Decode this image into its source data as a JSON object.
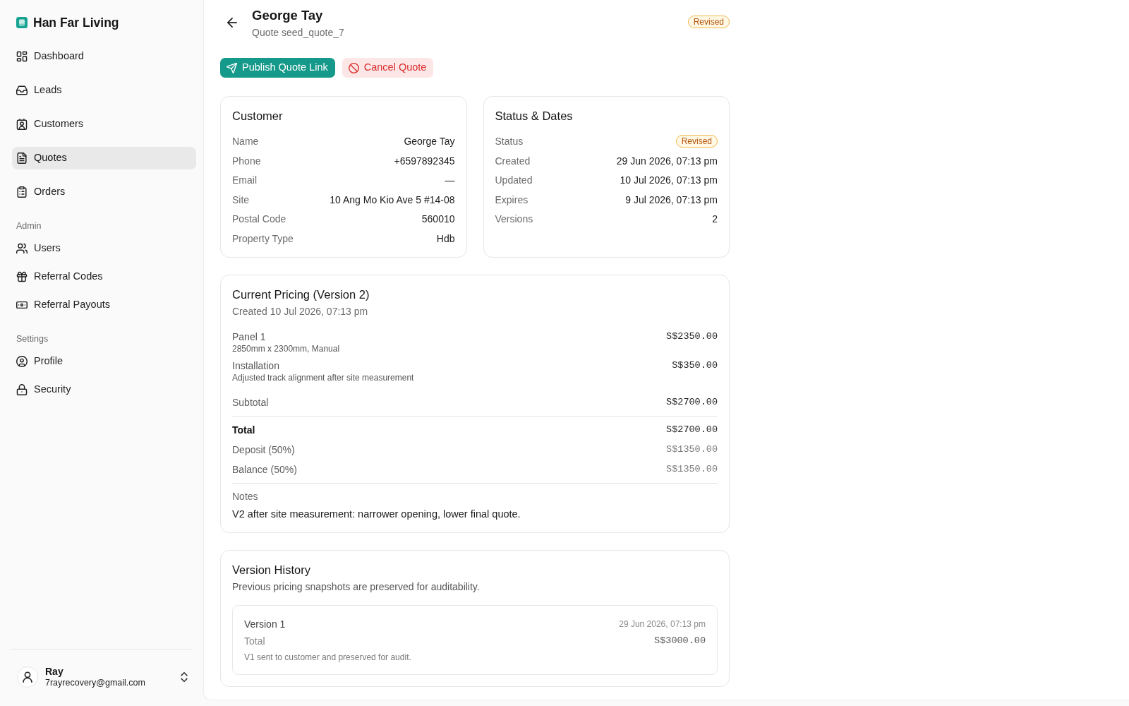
{
  "sidebar": {
    "brand": "Han Far Living",
    "sections": [
      {
        "items": [
          {
            "label": "Dashboard",
            "selected": false
          },
          {
            "label": "Leads",
            "selected": false
          },
          {
            "label": "Customers",
            "selected": false
          },
          {
            "label": "Quotes",
            "selected": true
          },
          {
            "label": "Orders",
            "selected": false
          }
        ]
      },
      {
        "heading": "Admin",
        "items": [
          {
            "label": "Users",
            "selected": false
          },
          {
            "label": "Referral Codes",
            "selected": false
          },
          {
            "label": "Referral Payouts",
            "selected": false
          }
        ]
      },
      {
        "heading": "Settings",
        "items": [
          {
            "label": "Profile",
            "selected": false
          },
          {
            "label": "Security",
            "selected": false
          }
        ]
      }
    ],
    "user": {
      "name": "Ray",
      "email": "7rayrecovery@gmail.com"
    }
  },
  "header": {
    "title": "George Tay",
    "subtitle": "Quote seed_quote_7",
    "status": "Revised"
  },
  "actions": [
    {
      "label": "Publish Quote Link",
      "kind": "primary"
    },
    {
      "label": "Cancel Quote",
      "kind": "danger"
    }
  ],
  "customer": {
    "title": "Customer",
    "fields": [
      {
        "label": "Name",
        "value": "George Tay"
      },
      {
        "label": "Phone",
        "value": "+6597892345"
      },
      {
        "label": "Email",
        "value": "—"
      },
      {
        "label": "Site",
        "value": "10 Ang Mo Kio Ave 5 #14-08"
      },
      {
        "label": "Postal Code",
        "value": "560010"
      },
      {
        "label": "Property Type",
        "value": "Hdb"
      }
    ]
  },
  "status_dates": {
    "title": "Status & Dates",
    "fields": [
      {
        "label": "Status",
        "value": "Revised",
        "kind": "badge"
      },
      {
        "label": "Created",
        "value": "29 Jun 2026, 07:13 pm",
        "kind": "text"
      },
      {
        "label": "Updated",
        "value": "10 Jul 2026, 07:13 pm",
        "kind": "text"
      },
      {
        "label": "Expires",
        "value": "9 Jul 2026, 07:13 pm",
        "kind": "text"
      },
      {
        "label": "Versions",
        "value": "2",
        "kind": "text"
      }
    ]
  },
  "pricing": {
    "title": "Current Pricing (Version 2)",
    "subtitle": "Created 10 Jul 2026, 07:13 pm",
    "line_items": [
      {
        "name": "Panel 1",
        "detail": "2850mm x 2300mm, Manual",
        "amount": "S$2350.00"
      },
      {
        "name": "Installation",
        "detail": "Adjusted track alignment after site measurement",
        "amount": "S$350.00"
      }
    ],
    "summary": [
      {
        "label": "Subtotal",
        "amount": "S$2700.00",
        "kind": "subtotal"
      },
      {
        "label": "Total",
        "amount": "S$2700.00",
        "kind": "total"
      },
      {
        "label": "Deposit (50%)",
        "amount": "S$1350.00",
        "kind": "split"
      },
      {
        "label": "Balance (50%)",
        "amount": "S$1350.00",
        "kind": "split"
      }
    ],
    "notes_label": "Notes",
    "notes": "V2 after site measurement: narrower opening, lower final quote."
  },
  "version_history": {
    "title": "Version History",
    "description": "Previous pricing snapshots are preserved for auditability.",
    "versions": [
      {
        "label": "Version 1",
        "date": "29 Jun 2026, 07:13 pm",
        "total_label": "Total",
        "total": "S$3000.00",
        "note": "V1 sent to customer and preserved for audit."
      }
    ]
  }
}
